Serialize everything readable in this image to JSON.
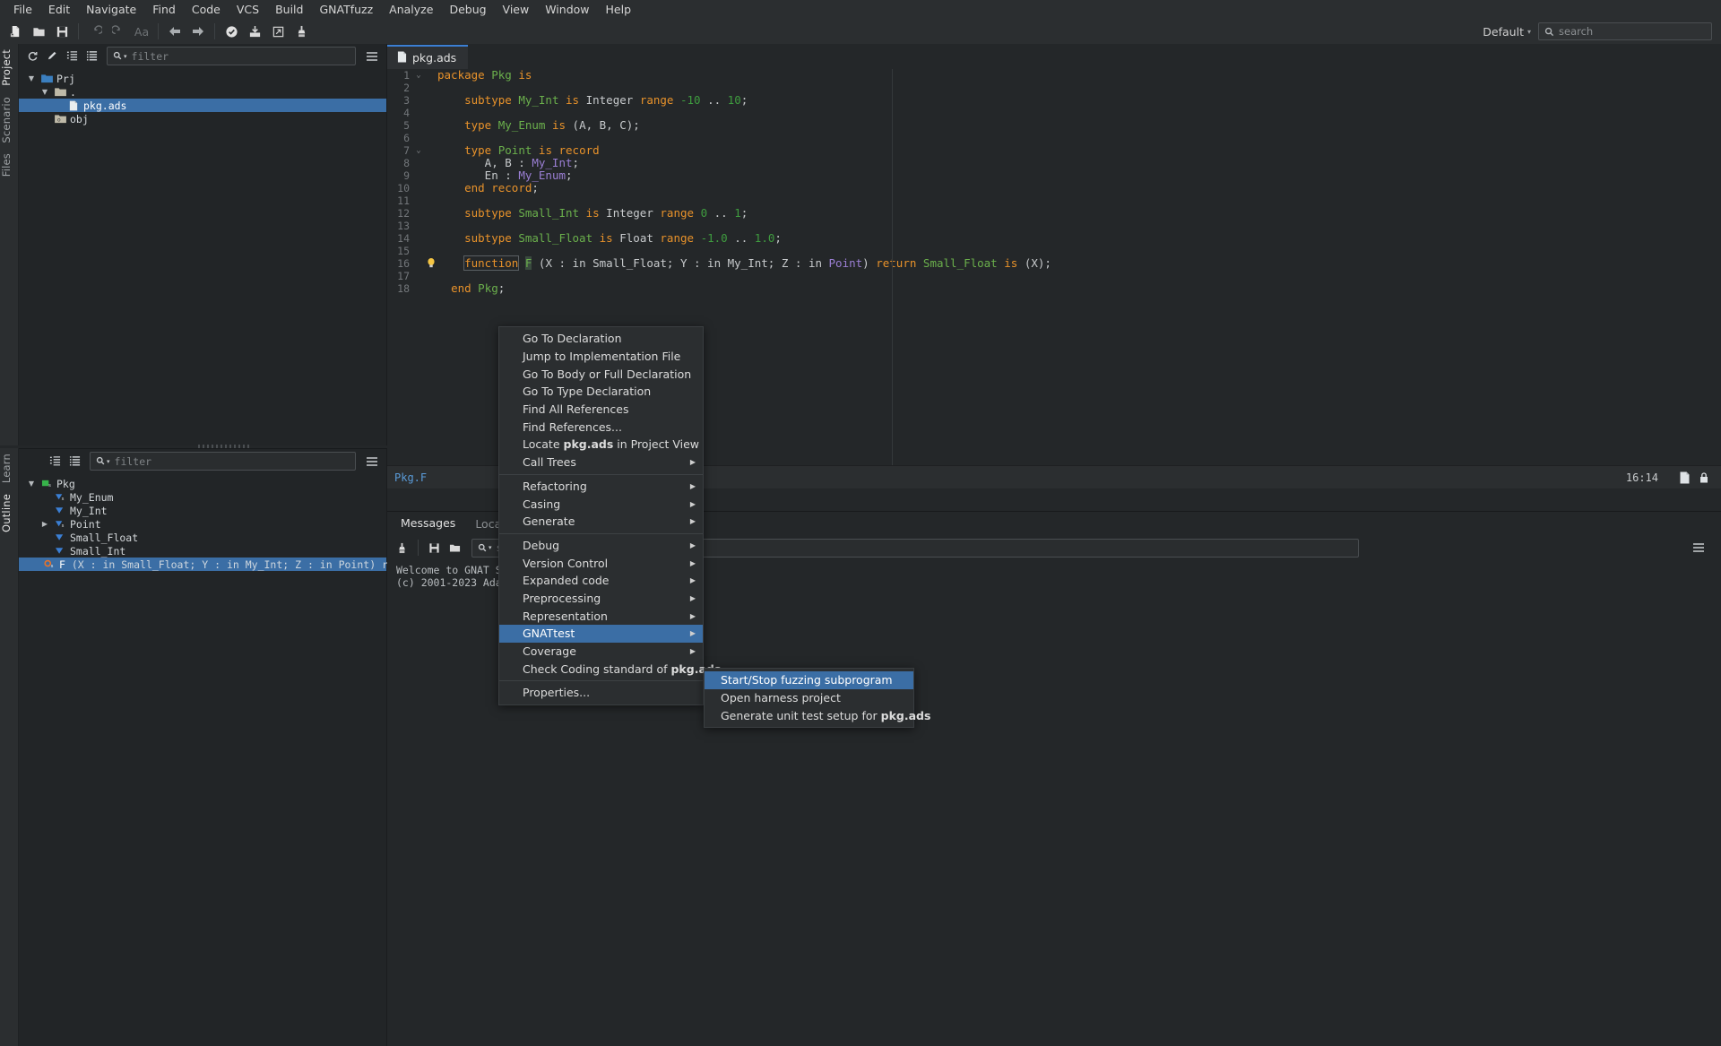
{
  "menubar": {
    "items": [
      {
        "label": "File"
      },
      {
        "label": "Edit"
      },
      {
        "label": "Navigate"
      },
      {
        "label": "Find"
      },
      {
        "label": "Code"
      },
      {
        "label": "VCS"
      },
      {
        "label": "Build"
      },
      {
        "label": "GNATfuzz"
      },
      {
        "label": "Analyze"
      },
      {
        "label": "Debug"
      },
      {
        "label": "View"
      },
      {
        "label": "Window"
      },
      {
        "label": "Help"
      }
    ]
  },
  "toolbar": {
    "buttons": [
      {
        "name": "new-file-icon"
      },
      {
        "name": "open-folder-icon"
      },
      {
        "name": "save-icon"
      },
      {
        "name": "undo-icon"
      },
      {
        "name": "redo-icon"
      },
      {
        "name": "font-size-icon",
        "text": "Aa"
      },
      {
        "name": "go-back-icon"
      },
      {
        "name": "go-forward-icon"
      },
      {
        "name": "check-syntax-icon"
      },
      {
        "name": "build-icon"
      },
      {
        "name": "run-icon"
      },
      {
        "name": "clean-icon"
      }
    ],
    "profile_label": "Default",
    "search_placeholder": "search"
  },
  "rails": {
    "left_top": [
      {
        "label": "Project",
        "active": true
      },
      {
        "label": "Scenario",
        "active": false
      },
      {
        "label": "Files",
        "active": false
      }
    ],
    "left_bottom": [
      {
        "label": "Learn",
        "active": false
      },
      {
        "label": "Outline",
        "active": true
      }
    ]
  },
  "project_panel": {
    "filter_placeholder": "filter",
    "toolbar_icons": [
      "refresh-icon",
      "edit-icon",
      "expand-all-icon",
      "collapse-all-icon",
      "menu-icon"
    ],
    "tree": [
      {
        "indent": 0,
        "arrow": "down",
        "icon": "folder-blue-icon",
        "label": "Prj",
        "selected": false
      },
      {
        "indent": 1,
        "arrow": "down",
        "icon": "folder-grey-icon",
        "label": ".",
        "selected": false
      },
      {
        "indent": 2,
        "arrow": "none",
        "icon": "file-icon",
        "label": "pkg.ads",
        "selected": true
      },
      {
        "indent": 1,
        "arrow": "none",
        "icon": "obj-folder-icon",
        "label": "obj",
        "selected": false
      }
    ]
  },
  "outline_panel": {
    "filter_placeholder": "filter",
    "toolbar_icons": [
      "sort-icon",
      "flat-view-icon",
      "menu-icon"
    ],
    "tree": [
      {
        "indent": 0,
        "arrow": "down",
        "icon": "package-icon",
        "label": "Pkg",
        "selected": false
      },
      {
        "indent": 1,
        "arrow": "none",
        "icon": "type-spec-icon",
        "label": "My_Enum",
        "selected": false
      },
      {
        "indent": 1,
        "arrow": "none",
        "icon": "type-icon",
        "label": "My_Int",
        "selected": false
      },
      {
        "indent": 1,
        "arrow": "right",
        "icon": "type-spec-icon",
        "label": "Point",
        "selected": false
      },
      {
        "indent": 1,
        "arrow": "none",
        "icon": "type-icon",
        "label": "Small_Float",
        "selected": false
      },
      {
        "indent": 1,
        "arrow": "none",
        "icon": "type-icon",
        "label": "Small_Int",
        "selected": false
      },
      {
        "indent": 1,
        "arrow": "none",
        "icon": "subprogram-icon",
        "label": "F (X : in Small_Float; Y : in My_Int; Z : in Point) return Small_Float",
        "selected": true
      }
    ]
  },
  "editor": {
    "tab": {
      "label": "pkg.ads",
      "icon": "file-icon"
    },
    "lines": [
      {
        "n": 1,
        "fold": "down",
        "bulb": false,
        "tokens": [
          {
            "t": "package ",
            "c": "kw"
          },
          {
            "t": "Pkg",
            "c": "ty"
          },
          {
            "t": " ",
            "c": "pl"
          },
          {
            "t": "is",
            "c": "kw"
          }
        ]
      },
      {
        "n": 2,
        "fold": "",
        "bulb": false,
        "tokens": []
      },
      {
        "n": 3,
        "fold": "",
        "bulb": false,
        "tokens": [
          {
            "t": "    ",
            "c": "pl"
          },
          {
            "t": "subtype ",
            "c": "kw"
          },
          {
            "t": "My_Int",
            "c": "ty"
          },
          {
            "t": " ",
            "c": "pl"
          },
          {
            "t": "is",
            "c": "kw"
          },
          {
            "t": " Integer ",
            "c": "pl"
          },
          {
            "t": "range",
            "c": "kw"
          },
          {
            "t": " ",
            "c": "pl"
          },
          {
            "t": "-10",
            "c": "num"
          },
          {
            "t": " .. ",
            "c": "pl"
          },
          {
            "t": "10",
            "c": "num"
          },
          {
            "t": ";",
            "c": "pl"
          }
        ]
      },
      {
        "n": 4,
        "fold": "",
        "bulb": false,
        "tokens": []
      },
      {
        "n": 5,
        "fold": "",
        "bulb": false,
        "tokens": [
          {
            "t": "    ",
            "c": "pl"
          },
          {
            "t": "type ",
            "c": "kw"
          },
          {
            "t": "My_Enum",
            "c": "ty"
          },
          {
            "t": " ",
            "c": "pl"
          },
          {
            "t": "is",
            "c": "kw"
          },
          {
            "t": " (A, B, C);",
            "c": "pl"
          }
        ]
      },
      {
        "n": 6,
        "fold": "",
        "bulb": false,
        "tokens": []
      },
      {
        "n": 7,
        "fold": "down",
        "bulb": false,
        "tokens": [
          {
            "t": "    ",
            "c": "pl"
          },
          {
            "t": "type ",
            "c": "kw"
          },
          {
            "t": "Point",
            "c": "ty"
          },
          {
            "t": " ",
            "c": "pl"
          },
          {
            "t": "is record",
            "c": "kw"
          }
        ]
      },
      {
        "n": 8,
        "fold": "",
        "bulb": false,
        "tokens": [
          {
            "t": "       A, B : ",
            "c": "pl"
          },
          {
            "t": "My_Int",
            "c": "id"
          },
          {
            "t": ";",
            "c": "pl"
          }
        ]
      },
      {
        "n": 9,
        "fold": "",
        "bulb": false,
        "tokens": [
          {
            "t": "       En : ",
            "c": "pl"
          },
          {
            "t": "My_Enum",
            "c": "id"
          },
          {
            "t": ";",
            "c": "pl"
          }
        ]
      },
      {
        "n": 10,
        "fold": "",
        "bulb": false,
        "tokens": [
          {
            "t": "    ",
            "c": "pl"
          },
          {
            "t": "end record",
            "c": "kw"
          },
          {
            "t": ";",
            "c": "pl"
          }
        ]
      },
      {
        "n": 11,
        "fold": "",
        "bulb": false,
        "tokens": []
      },
      {
        "n": 12,
        "fold": "",
        "bulb": false,
        "tokens": [
          {
            "t": "    ",
            "c": "pl"
          },
          {
            "t": "subtype ",
            "c": "kw"
          },
          {
            "t": "Small_Int",
            "c": "ty"
          },
          {
            "t": " ",
            "c": "pl"
          },
          {
            "t": "is",
            "c": "kw"
          },
          {
            "t": " Integer ",
            "c": "pl"
          },
          {
            "t": "range",
            "c": "kw"
          },
          {
            "t": " ",
            "c": "pl"
          },
          {
            "t": "0",
            "c": "num"
          },
          {
            "t": " .. ",
            "c": "pl"
          },
          {
            "t": "1",
            "c": "num"
          },
          {
            "t": ";",
            "c": "pl"
          }
        ]
      },
      {
        "n": 13,
        "fold": "",
        "bulb": false,
        "tokens": []
      },
      {
        "n": 14,
        "fold": "",
        "bulb": false,
        "tokens": [
          {
            "t": "    ",
            "c": "pl"
          },
          {
            "t": "subtype ",
            "c": "kw"
          },
          {
            "t": "Small_Float",
            "c": "ty"
          },
          {
            "t": " ",
            "c": "pl"
          },
          {
            "t": "is",
            "c": "kw"
          },
          {
            "t": " Float ",
            "c": "pl"
          },
          {
            "t": "range",
            "c": "kw"
          },
          {
            "t": " ",
            "c": "pl"
          },
          {
            "t": "-1.0",
            "c": "num"
          },
          {
            "t": " .. ",
            "c": "pl"
          },
          {
            "t": "1.0",
            "c": "num"
          },
          {
            "t": ";",
            "c": "pl"
          }
        ]
      },
      {
        "n": 15,
        "fold": "",
        "bulb": false,
        "tokens": []
      },
      {
        "n": 16,
        "fold": "",
        "bulb": true,
        "tokens": [
          {
            "t": "    ",
            "c": "pl"
          },
          {
            "t": "function",
            "c": "kw box"
          },
          {
            "t": " ",
            "c": "pl"
          },
          {
            "t": "F",
            "c": "ty sel"
          },
          {
            "t": " (X : in Small_Float; Y : in My_Int; Z : in ",
            "c": "pl"
          },
          {
            "t": "Point",
            "c": "id"
          },
          {
            "t": ") ",
            "c": "pl"
          },
          {
            "t": "return ",
            "c": "kw"
          },
          {
            "t": "Small_Float",
            "c": "ty"
          },
          {
            "t": " ",
            "c": "pl"
          },
          {
            "t": "is",
            "c": "kw"
          },
          {
            "t": " (X);",
            "c": "pl"
          }
        ]
      },
      {
        "n": 17,
        "fold": "",
        "bulb": false,
        "tokens": []
      },
      {
        "n": 18,
        "fold": "",
        "bulb": false,
        "tokens": [
          {
            "t": "  ",
            "c": "pl"
          },
          {
            "t": "end ",
            "c": "kw"
          },
          {
            "t": "Pkg",
            "c": "ty"
          },
          {
            "t": ";",
            "c": "pl"
          }
        ]
      }
    ]
  },
  "status_bar": {
    "path": "Pkg.F",
    "position": "16:14",
    "icons": [
      "file-state-icon",
      "read-only-icon"
    ]
  },
  "bottom_panel": {
    "tabs": [
      {
        "label": "Messages",
        "active": true
      },
      {
        "label": "Locations",
        "active": false
      }
    ],
    "toolbar_icons": [
      "clear-icon",
      "save-icon",
      "open-folder-icon"
    ],
    "search_placeholder": "search",
    "menu_icon": "menu-icon",
    "log_lines": [
      "Welcome to GNAT Studio 24",
      "(c) 2001-2023 AdaCore"
    ]
  },
  "context_menu": {
    "items": [
      {
        "label": "Go To Declaration",
        "submenu": false,
        "selected": false,
        "sep_after": false
      },
      {
        "label": "Jump to Implementation File",
        "submenu": false,
        "selected": false,
        "sep_after": false
      },
      {
        "label": "Go To Body or Full Declaration",
        "submenu": false,
        "selected": false,
        "sep_after": false
      },
      {
        "label": "Go To Type Declaration",
        "submenu": false,
        "selected": false,
        "sep_after": false
      },
      {
        "label": "Find All References",
        "submenu": false,
        "selected": false,
        "sep_after": false
      },
      {
        "label": "Find References...",
        "submenu": false,
        "selected": false,
        "sep_after": false
      },
      {
        "label": "Locate pkg.ads in Project View",
        "bold_part": "pkg.ads",
        "submenu": false,
        "selected": false,
        "sep_after": false
      },
      {
        "label": "Call Trees",
        "submenu": true,
        "selected": false,
        "sep_after": true
      },
      {
        "label": "Refactoring",
        "submenu": true,
        "selected": false,
        "sep_after": false
      },
      {
        "label": "Casing",
        "submenu": true,
        "selected": false,
        "sep_after": false
      },
      {
        "label": "Generate",
        "submenu": true,
        "selected": false,
        "sep_after": true
      },
      {
        "label": "Debug",
        "submenu": true,
        "selected": false,
        "sep_after": false
      },
      {
        "label": "Version Control",
        "submenu": true,
        "selected": false,
        "sep_after": false
      },
      {
        "label": "Expanded code",
        "submenu": true,
        "selected": false,
        "sep_after": false
      },
      {
        "label": "Preprocessing",
        "submenu": true,
        "selected": false,
        "sep_after": false
      },
      {
        "label": "Representation",
        "submenu": true,
        "selected": false,
        "sep_after": false
      },
      {
        "label": "GNATtest",
        "submenu": true,
        "selected": true,
        "sep_after": false
      },
      {
        "label": "Coverage",
        "submenu": true,
        "selected": false,
        "sep_after": false
      },
      {
        "label": "Check Coding standard of pkg.ads",
        "bold_part": "pkg.ads",
        "submenu": false,
        "selected": false,
        "sep_after": true
      },
      {
        "label": "Properties...",
        "submenu": false,
        "selected": false,
        "sep_after": false
      }
    ],
    "submenu": {
      "items": [
        {
          "label": "Start/Stop fuzzing subprogram",
          "selected": true
        },
        {
          "label": "Open harness project",
          "selected": false
        },
        {
          "label": "Generate unit test setup for pkg.ads",
          "bold_part": "pkg.ads",
          "selected": false
        }
      ]
    }
  },
  "colors": {
    "accent_blue": "#3b6ea5",
    "bg_main": "#242729",
    "bg_chrome": "#2b2e30",
    "bg_panel": "#222527",
    "keyword": "#e8922a",
    "type": "#6bb04c",
    "identifier": "#9b7fd4",
    "number": "#3f9c3f",
    "path_link": "#5a9bd8"
  }
}
